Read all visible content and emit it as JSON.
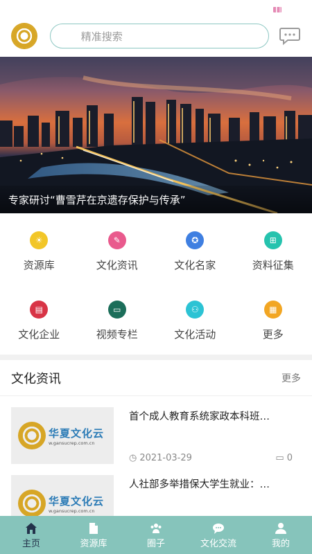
{
  "header": {
    "search_placeholder": "精准搜索"
  },
  "banner": {
    "caption": "专家研讨“曹雪芹在京遗存保护与传承”"
  },
  "grid": [
    {
      "label": "资源库",
      "icon": "sun-icon",
      "color": "#f2c628"
    },
    {
      "label": "文化资讯",
      "icon": "edit-icon",
      "color": "#e95a8d"
    },
    {
      "label": "文化名家",
      "icon": "medal-icon",
      "color": "#3f7fe1"
    },
    {
      "label": "资料征集",
      "icon": "collect-icon",
      "color": "#26c3ae"
    },
    {
      "label": "文化企业",
      "icon": "document-icon",
      "color": "#d83446"
    },
    {
      "label": "视频专栏",
      "icon": "video-icon",
      "color": "#1c6e5a"
    },
    {
      "label": "文化活动",
      "icon": "people-icon",
      "color": "#2cc3d4"
    },
    {
      "label": "更多",
      "icon": "grid-icon",
      "color": "#f2a623"
    }
  ],
  "news": {
    "title": "文化资讯",
    "more": "更多",
    "items": [
      {
        "title": "首个成人教育系统家政本科班…",
        "date": "2021-03-29",
        "comments": "0",
        "thumb_name": "华夏文化云",
        "thumb_url": "w.gansucrep.com.cn"
      },
      {
        "title": "人社部多举措保大学生就业：…",
        "thumb_name": "华夏文化云",
        "thumb_url": "w.gansucrep.com.cn"
      }
    ]
  },
  "tabs": [
    {
      "label": "主页",
      "icon": "home-icon",
      "active": true
    },
    {
      "label": "资源库",
      "icon": "file-icon",
      "active": false
    },
    {
      "label": "圈子",
      "icon": "group-icon",
      "active": false
    },
    {
      "label": "文化交流",
      "icon": "chat-icon",
      "active": false
    },
    {
      "label": "我的",
      "icon": "user-icon",
      "active": false
    }
  ],
  "colors": {
    "tabbar": "#86c4bb",
    "active_tab": "#23324a",
    "search_border": "#8cc7c2"
  }
}
